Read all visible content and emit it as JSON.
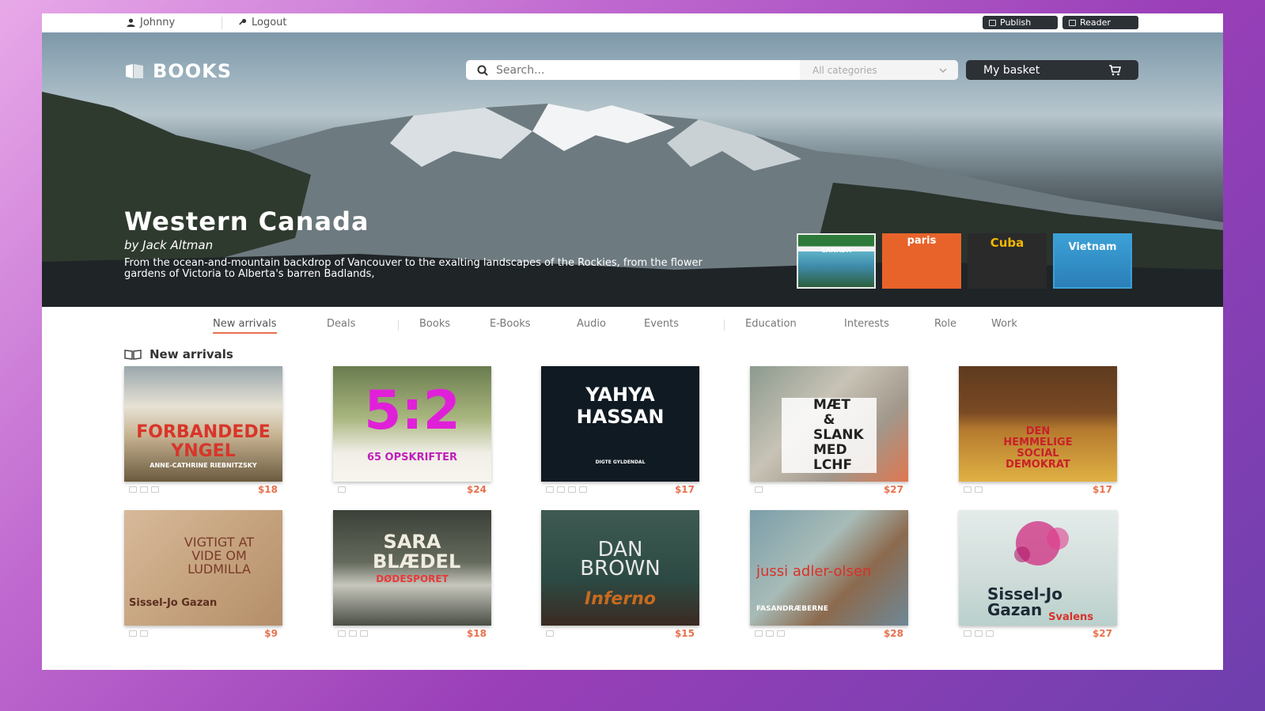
{
  "topbar": {
    "user": "Johnny",
    "logout": "Logout",
    "publish": "Publish",
    "reader": "Reader"
  },
  "header": {
    "brand": "BOOKS",
    "search_placeholder": "Search...",
    "category": "All categories",
    "basket": "My basket"
  },
  "hero": {
    "title": "Western Canada",
    "author": "by Jack Altman",
    "description": "From the ocean-and-mountain backdrop of Vancouver to the exalting landscapes of the Rockies, from the flower gardens of Victoria to Alberta's barren Badlands,",
    "covers": [
      {
        "label": "CANADA"
      },
      {
        "label": "paris"
      },
      {
        "label": "Cuba"
      },
      {
        "label": "Vietnam"
      }
    ]
  },
  "nav": {
    "items": [
      "New arrivals",
      "Deals",
      "Books",
      "E-Books",
      "Audio",
      "Events",
      "Education",
      "Interests",
      "Role",
      "Work"
    ]
  },
  "section": {
    "title": "New arrivals"
  },
  "books": [
    {
      "title": "FORBANDEDE YNGEL",
      "author": "ANNE-CATHRINE RIEBNITZSKY",
      "price": "$18"
    },
    {
      "title": "5:2",
      "author": "65 OPSKRIFTER",
      "price": "$24"
    },
    {
      "title": "YAHYA HASSAN",
      "author": "DIGTE GYLDENDAL",
      "price": "$17"
    },
    {
      "title": "MÆT & SLANK MED LCHF",
      "author": "",
      "price": "$27"
    },
    {
      "title": "DEN HEMMELIGE SOCIAL DEMOKRAT",
      "author": "",
      "price": "$17"
    },
    {
      "title": "VIGTIGT AT VIDE OM LUDMILLA",
      "author": "Sissel-Jo Gazan",
      "price": "$9"
    },
    {
      "title": "SARA BLÆDEL",
      "author": "DØDESPORET",
      "price": "$18"
    },
    {
      "title": "DAN BROWN",
      "author": "Inferno",
      "price": "$15"
    },
    {
      "title": "jussi adler-olsen",
      "author": "FASANDRÆBERNE",
      "price": "$28"
    },
    {
      "title": "Sissel-Jo Gazan",
      "author": "Svalens",
      "price": "$27"
    }
  ],
  "colors": {
    "accent": "#e8714e",
    "dark": "#2c3136"
  }
}
